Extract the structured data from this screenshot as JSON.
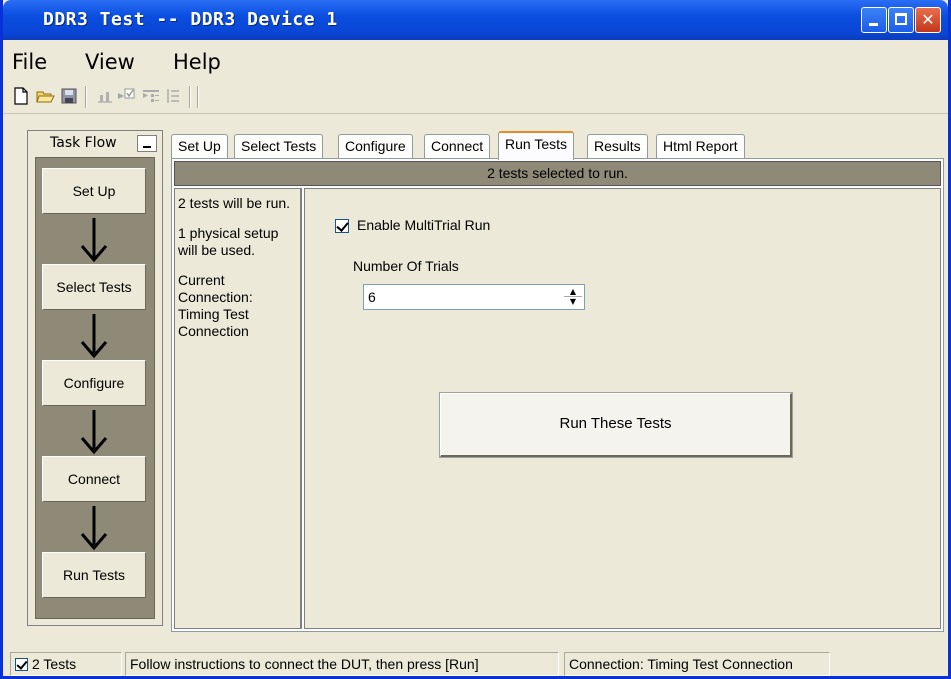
{
  "window": {
    "title": "DDR3 Test -- DDR3 Device 1"
  },
  "menu": {
    "items": [
      "File",
      "View",
      "Help"
    ]
  },
  "toolbar": {
    "icons": [
      "new-file-icon",
      "open-folder-icon",
      "save-icon",
      "chart-icon",
      "check-run-icon",
      "tests-list-icon",
      "list-icon"
    ]
  },
  "task_flow": {
    "title": "Task Flow",
    "steps": [
      "Set Up",
      "Select Tests",
      "Configure",
      "Connect",
      "Run Tests"
    ]
  },
  "tabs": [
    {
      "label": "Set Up",
      "active": false
    },
    {
      "label": "Select Tests",
      "active": false
    },
    {
      "label": "Configure",
      "active": false
    },
    {
      "label": "Connect",
      "active": false
    },
    {
      "label": "Run Tests",
      "active": true
    },
    {
      "label": "Results",
      "active": false
    },
    {
      "label": "Html Report",
      "active": false
    }
  ],
  "run_tests": {
    "header": "2 tests selected to run.",
    "info": {
      "tests": "2 tests will be run.",
      "setup": "1 physical setup will be used.",
      "connection": "Current Connection: Timing Test Connection"
    },
    "multitrial": {
      "label": "Enable MultiTrial Run",
      "checked": true
    },
    "trials": {
      "label": "Number Of Trials",
      "value": "6"
    },
    "run_button": "Run These Tests"
  },
  "statusbar": {
    "tests": "2 Tests",
    "message": "Follow instructions to connect the DUT, then press [Run]",
    "connection": "Connection: Timing Test Connection"
  },
  "colors": {
    "titlebar": "#0a4ee0",
    "panel_gray": "#8e8a77",
    "window_bg": "#ece9d8",
    "tab_accent": "#e68b2c"
  }
}
